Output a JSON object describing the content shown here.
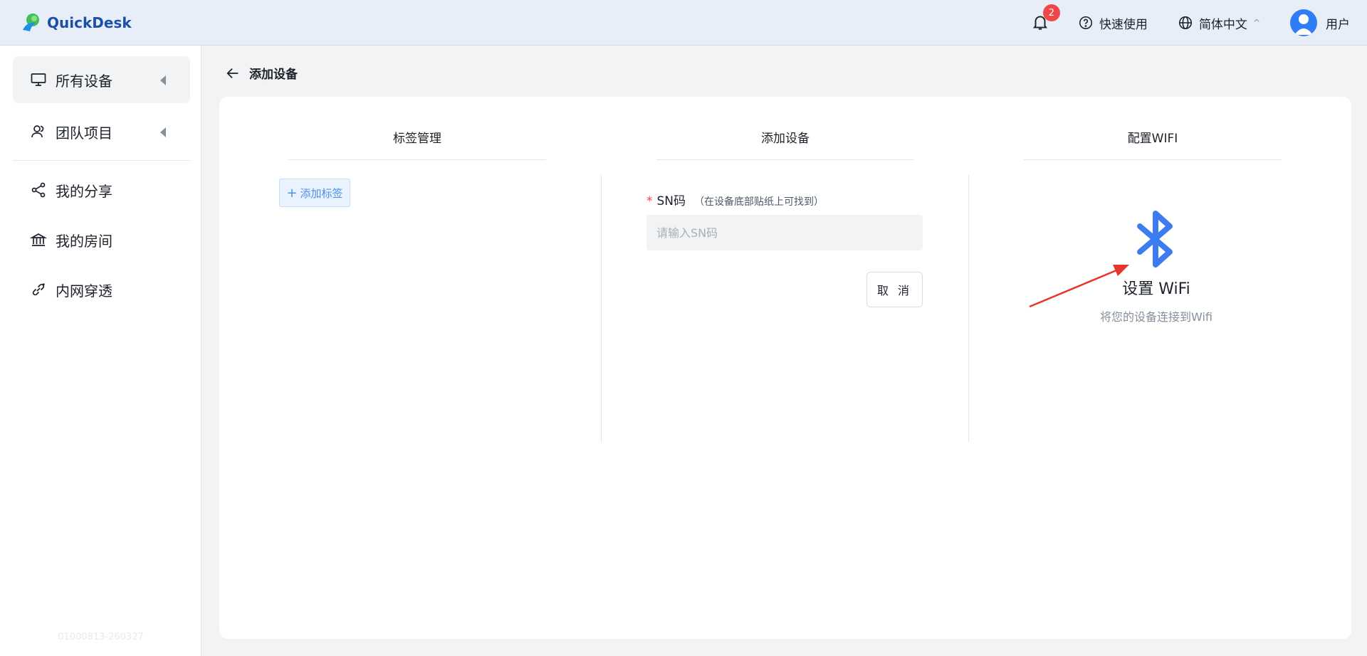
{
  "header": {
    "brand": "QuickDesk",
    "notification_count": "2",
    "help_label": "快速使用",
    "language_label": "简体中文",
    "language_caret": "^",
    "user_label": "用户"
  },
  "sidebar": {
    "items": [
      {
        "label": "所有设备",
        "icon": "monitor-icon",
        "expandable": true,
        "active": true
      },
      {
        "label": "团队项目",
        "icon": "team-icon",
        "expandable": true
      },
      {
        "label": "我的分享",
        "icon": "share-icon"
      },
      {
        "label": "我的房间",
        "icon": "bank-icon"
      },
      {
        "label": "内网穿透",
        "icon": "link-icon"
      }
    ],
    "version": "01000813-260327"
  },
  "page": {
    "title": "添加设备"
  },
  "columns": {
    "tags": {
      "title": "标签管理",
      "add_tag_label": "添加标签"
    },
    "add_device": {
      "title": "添加设备",
      "required_mark": "*",
      "sn_label": "SN码",
      "sn_hint": "（在设备底部贴纸上可找到）",
      "sn_placeholder": "请输入SN码",
      "sn_value": "",
      "cancel_label": "取 消"
    },
    "wifi": {
      "title": "配置WIFI",
      "card_title": "设置 WiFi",
      "card_subtitle": "将您的设备连接到Wifi",
      "icon": "bluetooth-icon"
    }
  },
  "colors": {
    "accent": "#2f7df6",
    "bluetooth": "#3d7cf0",
    "badge": "#f04848",
    "annotation_arrow": "#e8352a"
  }
}
